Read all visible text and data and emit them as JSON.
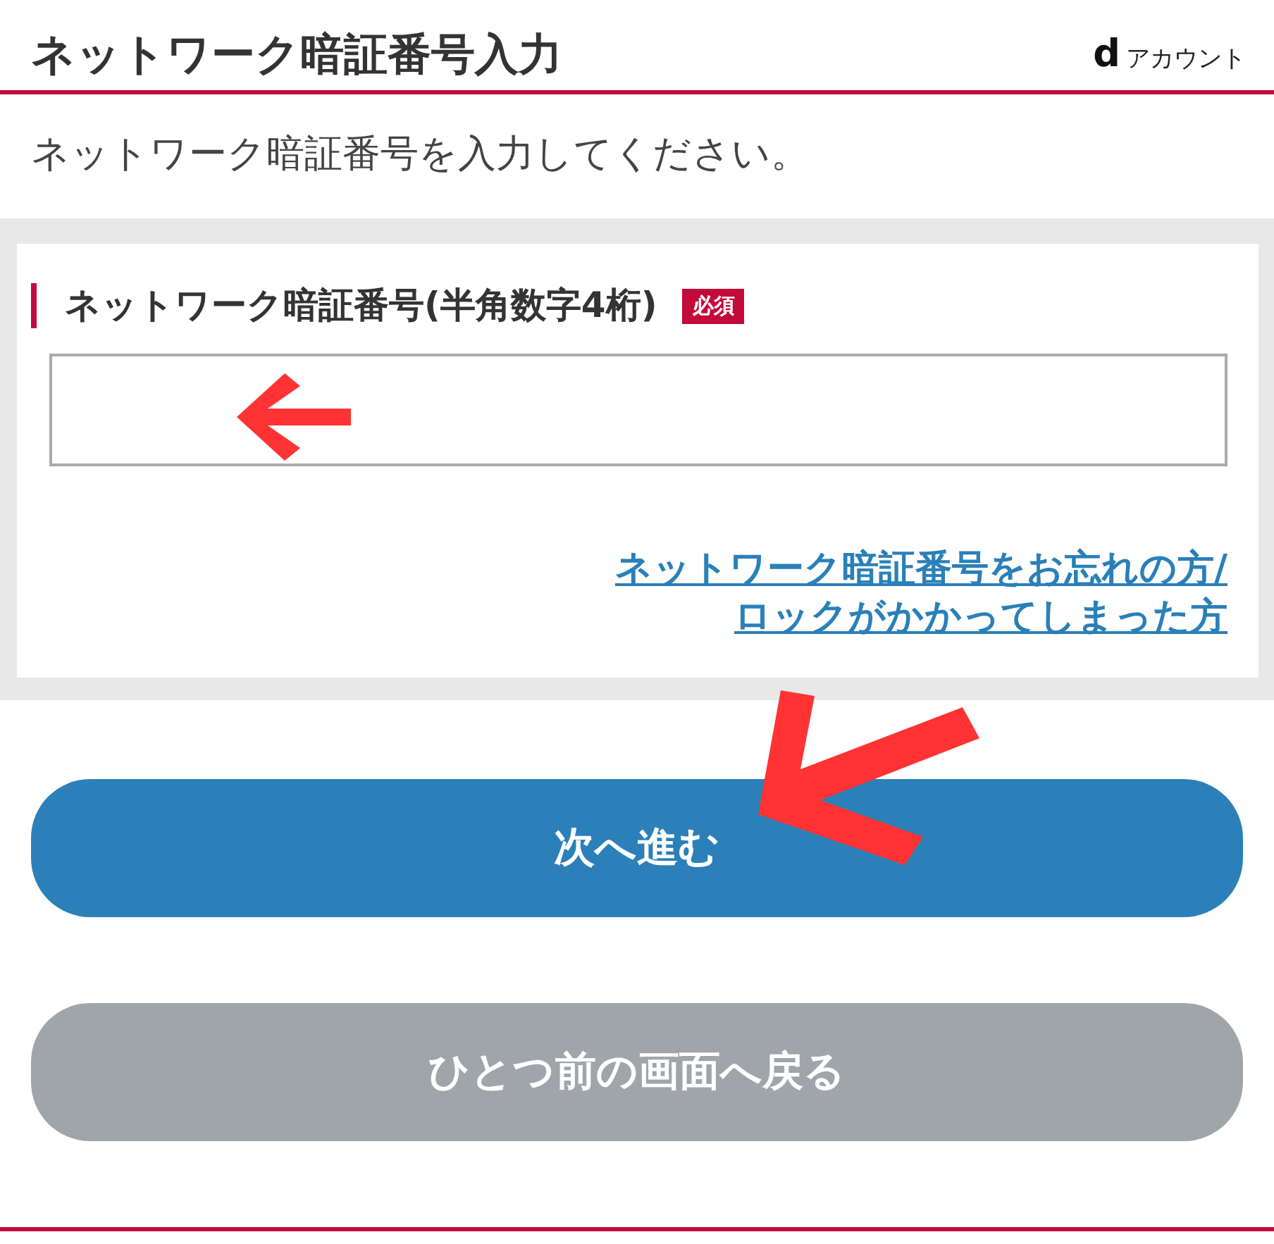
{
  "header": {
    "title": "ネットワーク暗証番号入力",
    "logo": {
      "mark": "d",
      "text": "アカウント"
    }
  },
  "instruction": "ネットワーク暗証番号を入力してください。",
  "form": {
    "label": "ネットワーク暗証番号(半角数字4桁)",
    "badge": "必須",
    "link_lines": [
      "ネットワーク暗証番号をお忘れの方/",
      "ロックがかかってしまった方"
    ]
  },
  "buttons": [
    {
      "label": "次へ進む",
      "kind": "primary"
    },
    {
      "label": "ひとつ前の画面へ戻る",
      "kind": "secondary"
    }
  ]
}
